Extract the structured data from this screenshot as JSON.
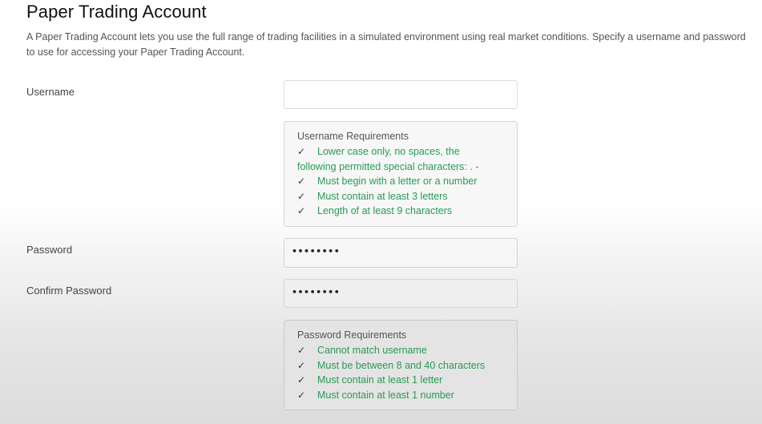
{
  "page": {
    "title": "Paper Trading Account",
    "description": "A Paper Trading Account lets you use the full range of trading facilities in a simulated environment using real market conditions. Specify a username and password to use for accessing your Paper Trading Account."
  },
  "form": {
    "username_label": "Username",
    "username_value": "",
    "password_label": "Password",
    "password_value": "••••••••",
    "confirm_label": "Confirm Password",
    "confirm_value": "••••••••"
  },
  "username_requirements": {
    "title": "Username Requirements",
    "items": [
      "Lower case only, no spaces, the",
      "following permitted special characters: . -",
      "Must begin with a letter or a number",
      "Must contain at least 3 letters",
      "Length of at least 9 characters"
    ]
  },
  "password_requirements": {
    "title": "Password Requirements",
    "items": [
      "Cannot match username",
      "Must be between 8 and 40 characters",
      "Must contain at least 1 letter",
      "Must contain at least 1 number"
    ]
  },
  "icons": {
    "check": "check-icon"
  },
  "colors": {
    "requirement_met": "#2a9a55",
    "title_text": "#111111",
    "body_text": "#555555"
  }
}
